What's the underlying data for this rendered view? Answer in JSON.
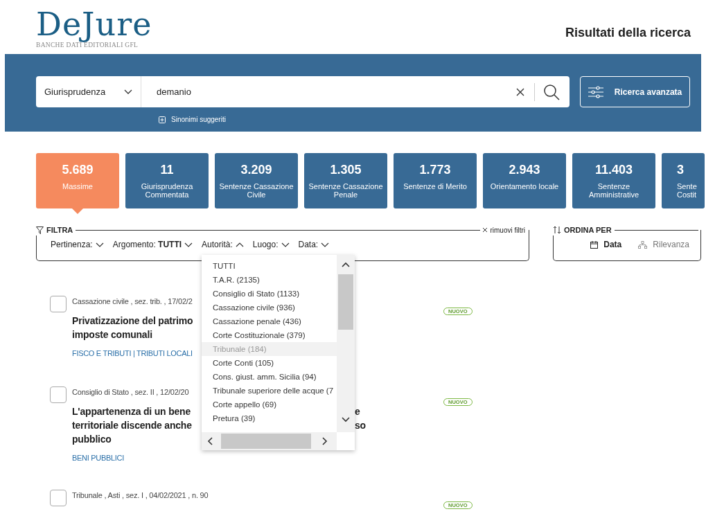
{
  "logo": {
    "name": "DeJure",
    "tagline": "BANCHE DATI EDITORIALI GFL"
  },
  "page_title": "Risultati della ricerca",
  "search": {
    "category": "Giurisprudenza",
    "value": "demanio",
    "advanced_button": "Ricerca avanzata",
    "synonyms_link": "Sinonimi suggeriti"
  },
  "tabs": [
    {
      "count": "5.689",
      "label": "Massime",
      "selected": true
    },
    {
      "count": "11",
      "label": "Giurisprudenza Commentata",
      "selected": false
    },
    {
      "count": "3.209",
      "label": "Sentenze Cassazione Civile",
      "selected": false
    },
    {
      "count": "1.305",
      "label": "Sentenze Cassazione Penale",
      "selected": false
    },
    {
      "count": "1.773",
      "label": "Sentenze di Merito",
      "selected": false
    },
    {
      "count": "2.943",
      "label": "Orientamento locale",
      "selected": false
    },
    {
      "count": "11.403",
      "label": "Sentenze Amministrative",
      "selected": false
    },
    {
      "count": "3",
      "label": "Sente Costit",
      "selected": false
    }
  ],
  "filter": {
    "title": "FILTRA",
    "clear": "rimuovi filtri",
    "items": [
      {
        "label": "Pertinenza:",
        "expanded": false
      },
      {
        "label": "Argomento:",
        "value": "TUTTI",
        "expanded": false
      },
      {
        "label": "Autorità:",
        "expanded": true
      },
      {
        "label": "Luogo:",
        "expanded": false
      },
      {
        "label": "Data:",
        "expanded": false
      }
    ]
  },
  "sort": {
    "title": "ORDINA PER",
    "options": [
      {
        "label": "Data",
        "selected": true
      },
      {
        "label": "Rilevanza",
        "selected": false
      }
    ]
  },
  "dropdown": {
    "items": [
      {
        "label": "TUTTI",
        "hovered": false
      },
      {
        "label": "T.A.R. (2135)",
        "hovered": false
      },
      {
        "label": "Consiglio di Stato (1133)",
        "hovered": false
      },
      {
        "label": "Cassazione civile (936)",
        "hovered": false
      },
      {
        "label": "Cassazione penale (436)",
        "hovered": false
      },
      {
        "label": "Corte Costituzionale (379)",
        "hovered": false
      },
      {
        "label": "Tribunale (184)",
        "hovered": true
      },
      {
        "label": "Corte Conti (105)",
        "hovered": false
      },
      {
        "label": "Cons. giust. amm. Sicilia (94)",
        "hovered": false
      },
      {
        "label": "Tribunale superiore delle acque (7",
        "hovered": false
      },
      {
        "label": "Corte appello (69)",
        "hovered": false
      },
      {
        "label": "Pretura (39)",
        "hovered": false
      }
    ]
  },
  "results": [
    {
      "meta": "Cassazione civile , sez. trib. , 17/02/2",
      "checked": false,
      "badge": "NUOVO",
      "title_lines": [
        {
          "text": "Privatizzazione del patrimo"
        },
        {
          "text": "imposte comunali"
        }
      ],
      "tags": "FISCO E TRIBUTI | TRIBUTI LOCALI"
    },
    {
      "meta": "Consiglio di Stato , sez. II , 12/02/20",
      "checked": false,
      "badge": "NUOVO",
      "title_lines": [
        {
          "text": "L'appartenenza di un bene",
          "after": "e"
        },
        {
          "text": "territoriale discende anche",
          "after": "so"
        },
        {
          "text": "pubblico"
        }
      ],
      "tags": "BENI PUBBLICI"
    },
    {
      "meta": "Tribunale , Asti , sez. I , 04/02/2021 , n. 90",
      "checked": false,
      "badge": "NUOVO"
    }
  ]
}
